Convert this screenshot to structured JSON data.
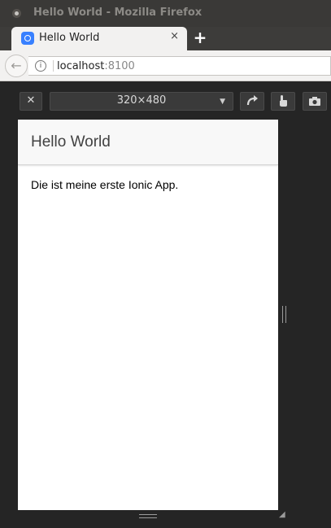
{
  "window": {
    "title": "Hello World - Mozilla Firefox"
  },
  "tab": {
    "label": "Hello World",
    "close_glyph": "×"
  },
  "newtab": {
    "glyph": "+"
  },
  "urlbar": {
    "host": "localhost",
    "port": ":8100"
  },
  "rdm": {
    "close_glyph": "✕",
    "preset": "320×480",
    "rotate_icon": "rotate-icon",
    "touch_icon": "touch-icon",
    "screenshot_icon": "camera-icon"
  },
  "app": {
    "title": "Hello World",
    "content": "Die ist meine erste Ionic App."
  }
}
